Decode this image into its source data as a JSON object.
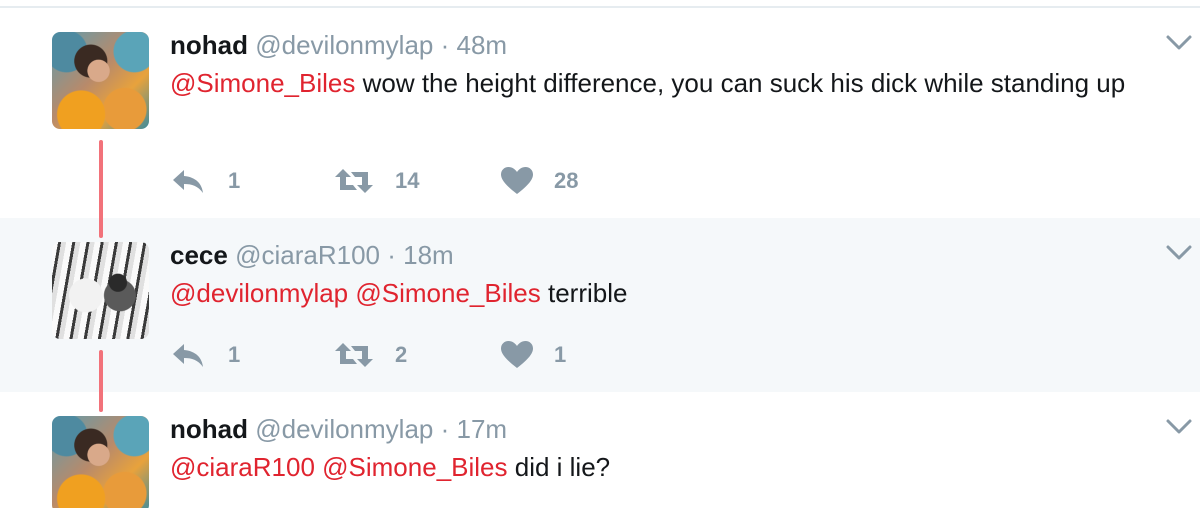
{
  "tweets": [
    {
      "name": "nohad",
      "handle": "@devilonmylap",
      "separator": "·",
      "time": "48m",
      "mentions": [
        "@Simone_Biles"
      ],
      "text": " wow the height difference, you can suck his dick while standing up",
      "counts": {
        "reply": "1",
        "retweet": "14",
        "like": "28"
      },
      "avatar_icon": "avatar-woman"
    },
    {
      "name": "cece",
      "handle": "@ciaraR100",
      "separator": "·",
      "time": "18m",
      "mentions": [
        "@devilonmylap",
        "@Simone_Biles"
      ],
      "text": " terrible",
      "counts": {
        "reply": "1",
        "retweet": "2",
        "like": "1"
      },
      "avatar_icon": "avatar-tiger"
    },
    {
      "name": "nohad",
      "handle": "@devilonmylap",
      "separator": "·",
      "time": "17m",
      "mentions": [
        "@ciaraR100",
        "@Simone_Biles"
      ],
      "text": " did i lie?",
      "avatar_icon": "avatar-woman"
    }
  ],
  "colors": {
    "mention": "#e0242f",
    "thread_line": "#f2727a",
    "muted": "#8899a6",
    "text": "#14171a",
    "highlight_bg": "#f5f8fa"
  },
  "icons": {
    "reply": "reply-icon",
    "retweet": "retweet-icon",
    "like": "heart-icon",
    "more": "chevron-down-icon"
  }
}
